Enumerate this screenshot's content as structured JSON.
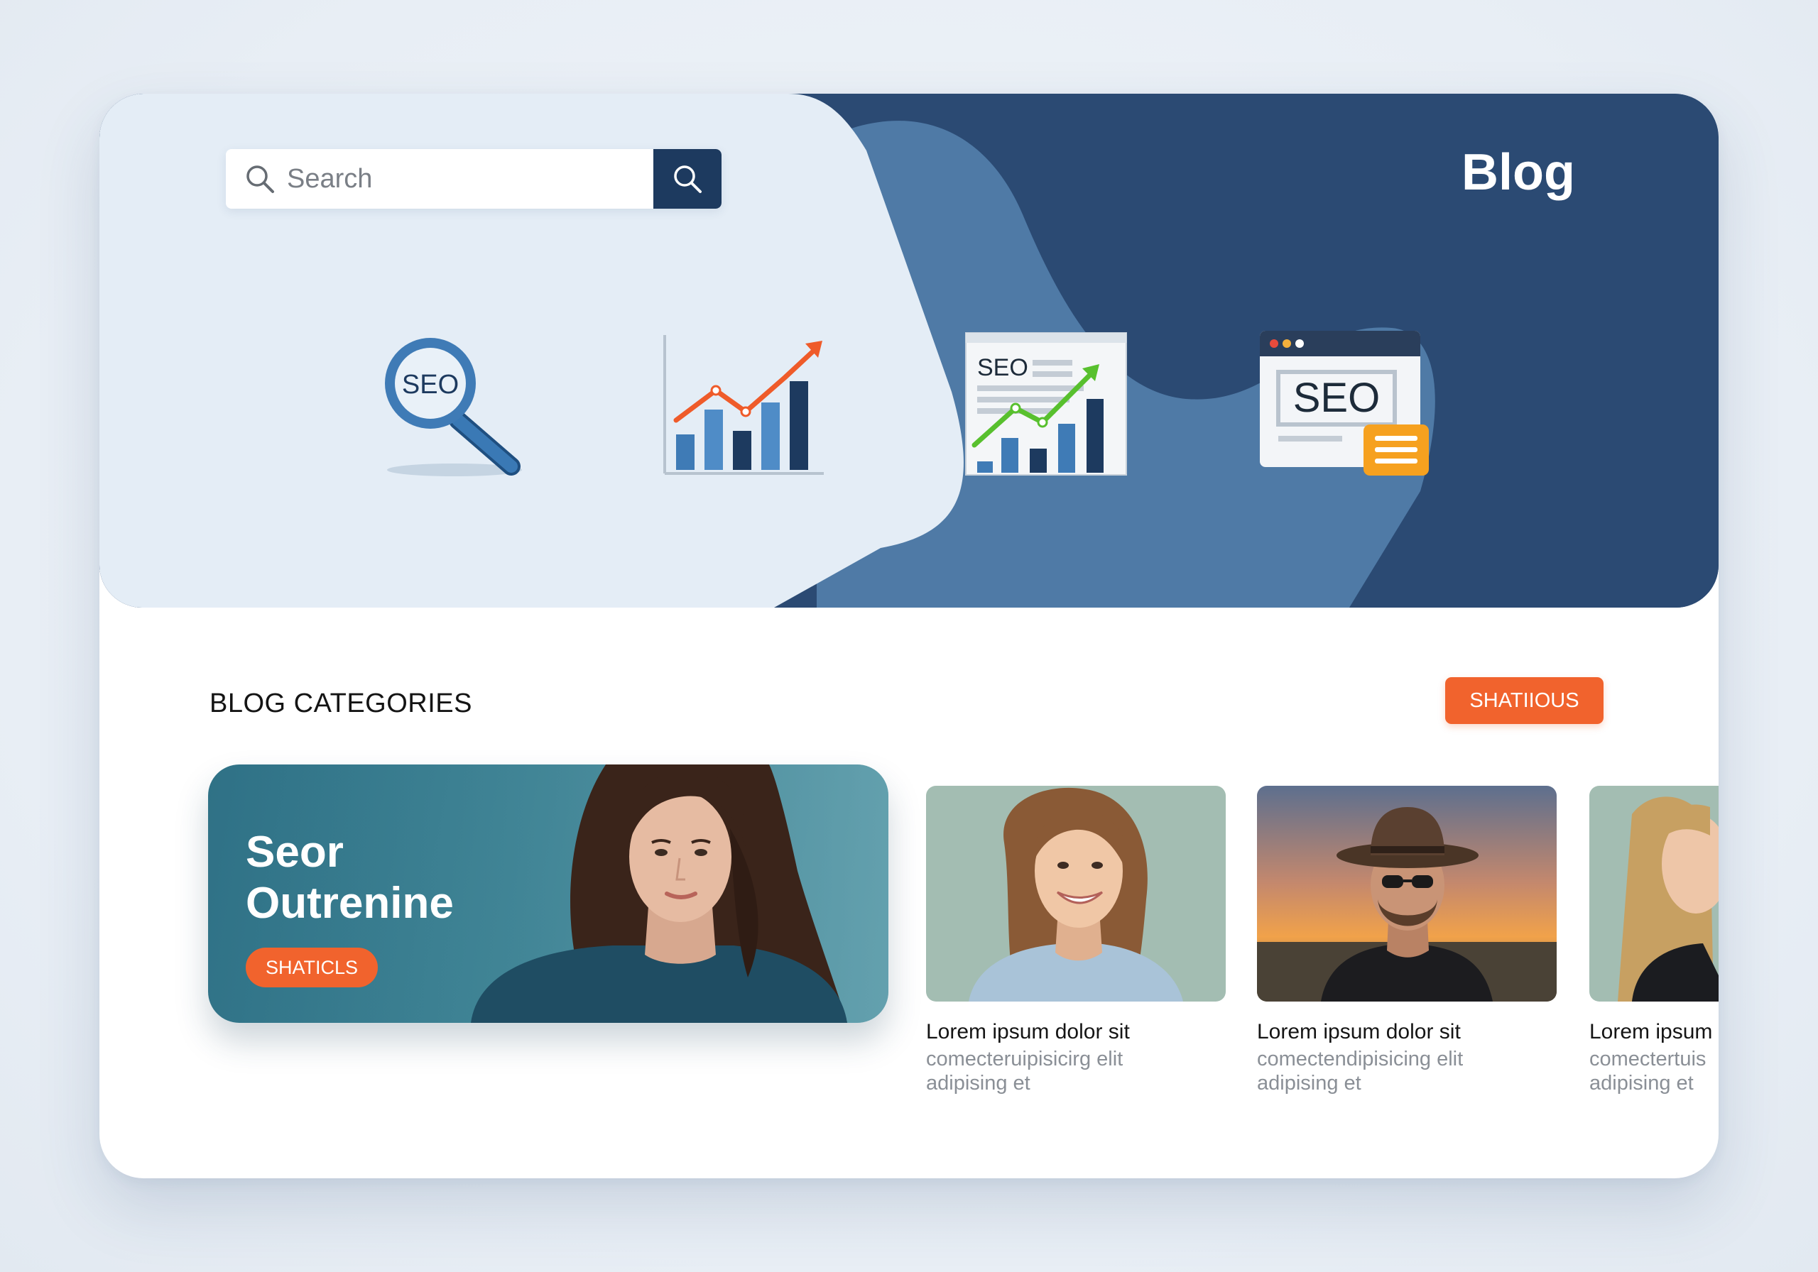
{
  "header": {
    "title": "Blog",
    "search": {
      "placeholder": "Search",
      "value": ""
    }
  },
  "hero_illustrations": [
    {
      "icon": "seo-magnifier-icon",
      "label": "SEO"
    },
    {
      "icon": "growth-chart-icon"
    },
    {
      "icon": "seo-report-icon",
      "label": "SEO"
    },
    {
      "icon": "seo-browser-window-icon",
      "label": "SEO"
    }
  ],
  "categories": {
    "heading": "BLOG CATEGORIES",
    "action_label": "SHATIIOUS"
  },
  "featured": {
    "title_line1": "Seor",
    "title_line2": "Outrenine",
    "tag": "SHATICLS"
  },
  "posts": [
    {
      "title": "Lorem ipsum dolor sit",
      "excerpt_line1": "comecteruipisicirg elit",
      "excerpt_line2": "adipising et"
    },
    {
      "title": "Lorem ipsum dolor sit",
      "excerpt_line1": "comectendipisicing elit",
      "excerpt_line2": "adipising et"
    },
    {
      "title": "Lorem ipsum",
      "excerpt_line1": "comectertuis",
      "excerpt_line2": "adipising et"
    }
  ],
  "colors": {
    "navy": "#2b4a73",
    "mid_blue": "#4f7aa6",
    "light_panel": "#e4edf6",
    "accent_orange": "#f1632d",
    "search_button": "#1d3a5f"
  }
}
